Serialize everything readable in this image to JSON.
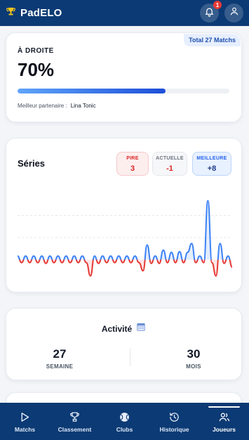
{
  "header": {
    "title": "PadELO",
    "notification_count": "1"
  },
  "summary": {
    "total_badge": "Total 27 Matchs",
    "side_label": "À DROITE",
    "percent_text": "70%",
    "progress_fraction": 0.7,
    "partner_label": "Meilleur partenaire :",
    "partner_name": "Lina Tonic"
  },
  "series": {
    "title": "Séries",
    "worst_label": "PIRE",
    "worst_value": "3",
    "current_label": "ACTUELLE",
    "current_value": "-1",
    "best_label": "MEILLEURE",
    "best_value": "+8"
  },
  "chart_data": {
    "type": "area",
    "values": [
      0.5,
      -0.4,
      0.5,
      -0.4,
      0.5,
      -0.4,
      0.5,
      -0.5,
      0.5,
      -0.4,
      0.5,
      -0.4,
      0.5,
      -0.4,
      0.5,
      -0.4,
      0.5,
      -0.4,
      -2.2,
      0.5,
      -0.5,
      0.5,
      -0.4,
      0.5,
      -0.4,
      0.5,
      -0.4,
      0.5,
      -0.4,
      0.5,
      -0.4,
      -1.5,
      2,
      -0.5,
      0.5,
      -0.5,
      1.3,
      -0.4,
      1,
      -0.4,
      1.1,
      -0.4,
      1,
      2.2,
      -0.4,
      0.5,
      -0.4,
      8,
      -0.4,
      -2.2,
      2.2,
      -0.5,
      0.5,
      -1
    ],
    "positive_color": "#3b82f6",
    "negative_color": "#e53935",
    "grid": true
  },
  "activity": {
    "title": "Activité",
    "week_value": "27",
    "week_label": "SEMAINE",
    "month_value": "30",
    "month_label": "MOIS"
  },
  "nav": {
    "items": [
      {
        "label": "Matchs",
        "icon": "play-icon"
      },
      {
        "label": "Classement",
        "icon": "trophy-icon"
      },
      {
        "label": "Clubs",
        "icon": "ball-icon"
      },
      {
        "label": "Historique",
        "icon": "history-icon"
      },
      {
        "label": "Joueurs",
        "icon": "users-icon"
      }
    ],
    "active": "Joueurs"
  }
}
